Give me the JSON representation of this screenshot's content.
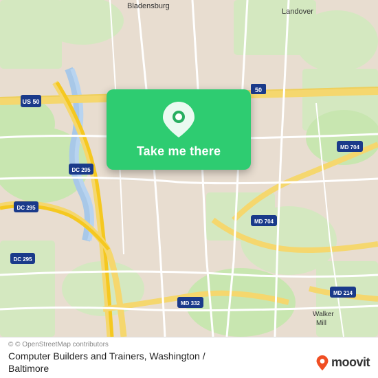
{
  "map": {
    "background_color": "#e8ddd0",
    "center_lat": 38.88,
    "center_lng": -76.95
  },
  "action_card": {
    "button_label": "Take me there",
    "background_color": "#27ae60",
    "icon": "location-pin-icon"
  },
  "bottom_bar": {
    "attribution": "© OpenStreetMap contributors",
    "place_name": "Computer Builders and Trainers, Washington /",
    "place_name_line2": "Baltimore",
    "moovit_label": "moovit"
  }
}
